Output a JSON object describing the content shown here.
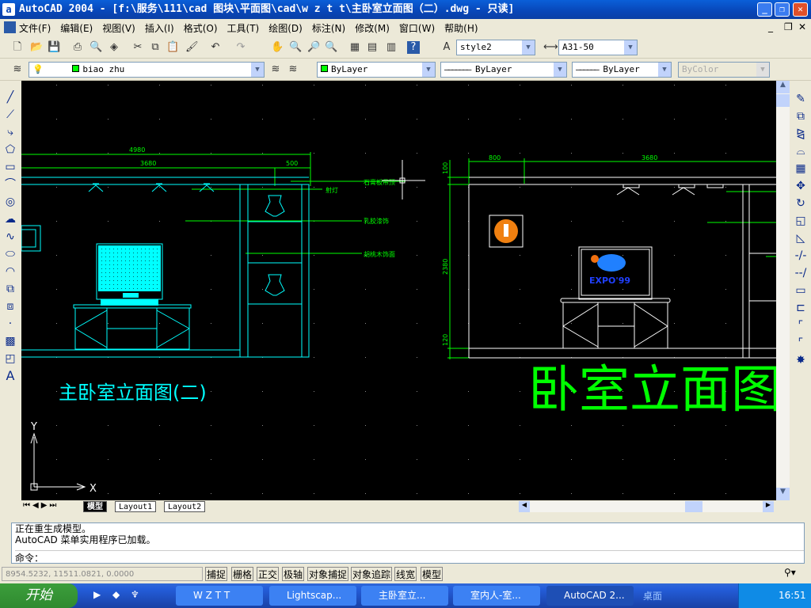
{
  "window": {
    "title": "AutoCAD 2004 - [f:\\服务\\111\\cad 图块\\平面图\\cad\\w z t t\\主卧室立面图（二）.dwg - 只读]",
    "min": "_",
    "restore": "❐",
    "close": "✕"
  },
  "menu": [
    "文件(F)",
    "编辑(E)",
    "视图(V)",
    "插入(I)",
    "格式(O)",
    "工具(T)",
    "绘图(D)",
    "标注(N)",
    "修改(M)",
    "窗口(W)",
    "帮助(H)"
  ],
  "toolbar": {
    "text_style": "style2",
    "dim_style": "A31-50",
    "layer": "biao zhu",
    "color": "ByLayer",
    "linetype": "ByLayer",
    "lineweight": "ByLayer",
    "plotstyle": "ByColor"
  },
  "drawing": {
    "left": {
      "dim_total": "4980",
      "dim_main": "3680",
      "dim_side": "500",
      "labels": [
        "石膏板吊顶",
        "射灯",
        "乳胶漆饰",
        "胡桃木饰面"
      ],
      "title": "主卧室立面图(二)"
    },
    "right": {
      "dim_a": "800",
      "dim_b": "3680",
      "dim_top": "100",
      "dim_height": "2380",
      "dim_base": "120",
      "tv_brand": "EXPO'99",
      "title": "卧室立面图"
    },
    "ucs_x": "X",
    "ucs_y": "Y",
    "colors": {
      "cyan": "#00ffff",
      "green": "#00ff00",
      "white": "#ffffff"
    }
  },
  "tabs": [
    "模型",
    "Layout1",
    "Layout2"
  ],
  "command": {
    "lines": [
      "正在重生成模型。",
      "AutoCAD 菜单实用程序已加载。"
    ],
    "prompt": "命令："
  },
  "status": {
    "coords": "8954.5232, 11511.0821, 0.0000",
    "buttons": [
      "捕捉",
      "栅格",
      "正交",
      "极轴",
      "对象捕捉",
      "对象追踪",
      "线宽",
      "模型"
    ]
  },
  "taskbar": {
    "start": "开始",
    "tasks": [
      "W Z T T",
      "Lightscap...",
      "主卧室立...",
      "室内人-室...",
      "AutoCAD 2..."
    ],
    "desktop": "桌面",
    "clock": "16:51"
  }
}
